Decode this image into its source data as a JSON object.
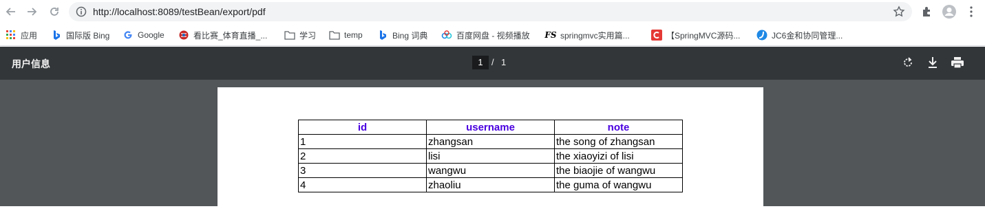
{
  "browser": {
    "url": "http://localhost:8089/testBean/export/pdf",
    "icons": [
      "back-icon",
      "forward-icon",
      "reload-icon",
      "info-icon",
      "star-icon",
      "extensions-icon",
      "profile-icon",
      "menu-icon"
    ]
  },
  "bookmarks": [
    {
      "label": "应用",
      "icon": "apps-grid-icon"
    },
    {
      "label": "国际版 Bing",
      "icon": "bing-icon"
    },
    {
      "label": "Google",
      "icon": "google-icon"
    },
    {
      "label": "看比赛_体育直播_...",
      "icon": "sports-icon"
    },
    {
      "label": "学习",
      "icon": "folder-icon"
    },
    {
      "label": "temp",
      "icon": "folder-icon"
    },
    {
      "label": "Bing 词典",
      "icon": "bing-icon"
    },
    {
      "label": "百度网盘 - 视频播放",
      "icon": "baidu-cloud-icon"
    },
    {
      "label": "springmvc实用篇...",
      "icon": "fs-icon"
    },
    {
      "label": "【SpringMVC源码...",
      "icon": "csdn-icon"
    },
    {
      "label": "JC6金和协同管理...",
      "icon": "jc6-icon"
    }
  ],
  "pdf": {
    "title": "用户信息",
    "current_page": "1",
    "separator": "/",
    "total_pages": "1",
    "icons": [
      "rotate-icon",
      "download-icon",
      "print-icon"
    ]
  },
  "table": {
    "headers": [
      "id",
      "username",
      "note"
    ],
    "rows": [
      [
        "1",
        "zhangsan",
        "the song of zhangsan"
      ],
      [
        "2",
        "lisi",
        "the xiaoyizi of lisi"
      ],
      [
        "3",
        "wangwu",
        "the biaojie of wangwu"
      ],
      [
        "4",
        "zhaoliu",
        "the guma of wangwu"
      ]
    ]
  },
  "colors": {
    "pdf_toolbar": "#323639",
    "viewer_bg": "#525659",
    "header_text": "#4a00e0"
  }
}
